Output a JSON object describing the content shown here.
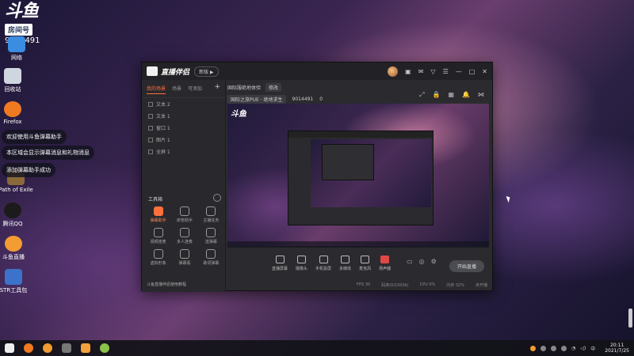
{
  "desktop": {
    "logo_text": "斗鱼",
    "room_label": "房间号",
    "room_number": "9014491",
    "icons": [
      {
        "label": "网络",
        "color": "#3a8de0"
      },
      {
        "label": "回收站",
        "color": "#cfd6e0"
      },
      {
        "label": "Firefox",
        "color": "#f07a22"
      },
      {
        "label": "Path of Exile",
        "color": "#8a6a3a"
      },
      {
        "label": "腾讯QQ",
        "color": "#1b1b1b"
      },
      {
        "label": "斗鱼直播",
        "color": "#f39c32"
      },
      {
        "label": "STR工具包",
        "color": "#3c72c9"
      }
    ],
    "notifications": [
      "欢迎使用斗鱼弹幕助手",
      "本区域会显示弹幕消息和礼物消息",
      "添加弹幕助手成功"
    ]
  },
  "app": {
    "title": "直播伴侣",
    "version_pill": "新版 ▶",
    "titlebar_icons": [
      "avatar",
      "skin-icon",
      "message-icon",
      "filter-icon",
      "settings-icon",
      "minimize-icon",
      "maximize-icon",
      "close-icon"
    ],
    "left_tabs": [
      "我的场景",
      "场景",
      "可添加"
    ],
    "sources": [
      "文本 2",
      "文本 1",
      "窗口 1",
      "图片 1",
      "全屏 1"
    ],
    "tools_title": "工具箱",
    "tools": [
      {
        "label": "弹幕助手",
        "active": true
      },
      {
        "label": "房管助手",
        "active": false
      },
      {
        "label": "主播任务",
        "active": false
      },
      {
        "label": "视频连麦",
        "active": false
      },
      {
        "label": "多人连麦",
        "active": false
      },
      {
        "label": "送弹幕",
        "active": false
      },
      {
        "label": "虚拟形象",
        "active": false
      },
      {
        "label": "弹幕看",
        "active": false
      },
      {
        "label": "歌词弹幕",
        "active": false
      }
    ],
    "left_footer": "斗鱼直播伴侣使用教程",
    "header": {
      "category": "国际服绝地体验",
      "tag": "修改",
      "room_type": "国际之旅PUE · 绝地求生",
      "room_number": "9014491",
      "viewers": "0"
    },
    "controls": [
      {
        "label": "直播屏幕",
        "icon": "screen-icon"
      },
      {
        "label": "摄像头",
        "icon": "camera-icon"
      },
      {
        "label": "手机投屏",
        "icon": "phone-icon"
      },
      {
        "label": "多媒体",
        "icon": "media-icon"
      },
      {
        "label": "麦克风",
        "icon": "mic-icon"
      },
      {
        "label": "扬声器",
        "icon": "speaker-icon"
      }
    ],
    "start_button": "开始直播",
    "status": [
      "FPS 30",
      "码率(0/1000k)",
      "CPU 0%",
      "内存 32%",
      "未开播"
    ]
  },
  "taskbar": {
    "apps": [
      {
        "name": "windows",
        "color": "#eeeeee"
      },
      {
        "name": "firefox",
        "color": "#f07a22"
      },
      {
        "name": "douyu",
        "color": "#f39c32"
      },
      {
        "name": "g-app",
        "color": "#777777"
      },
      {
        "name": "live-companion",
        "color": "#f3a03a"
      },
      {
        "name": "tool-app",
        "color": "#8bc34a"
      }
    ],
    "time": "20:11",
    "date": "2021/7/25",
    "lang": "中"
  }
}
